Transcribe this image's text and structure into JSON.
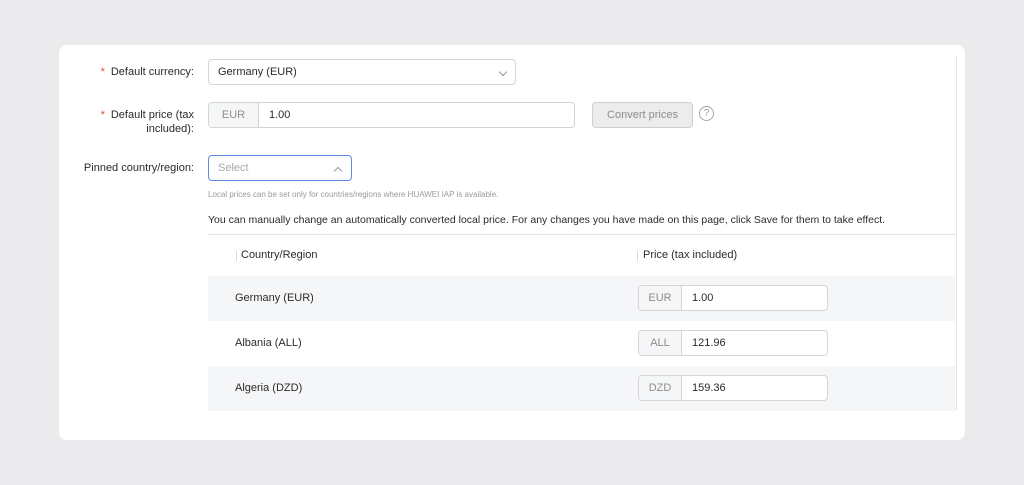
{
  "form": {
    "default_currency": {
      "label": "Default currency:",
      "value": "Germany (EUR)"
    },
    "default_price": {
      "label_line1": "Default price (tax",
      "label_line2": "included):",
      "currency": "EUR",
      "value": "1.00"
    },
    "convert_button": "Convert prices",
    "help_glyph": "?",
    "pinned": {
      "label": "Pinned country/region:",
      "placeholder": "Select"
    },
    "hint": "Local prices can be set only for countries/regions where HUAWEI IAP is available.",
    "note": "You can manually change an automatically converted local price. For any changes you have made on this page, click Save for them to take effect."
  },
  "table": {
    "headers": [
      "Country/Region",
      "Price (tax included)"
    ],
    "rows": [
      {
        "country": "Germany (EUR)",
        "currency": "EUR",
        "price": "1.00"
      },
      {
        "country": "Albania (ALL)",
        "currency": "ALL",
        "price": "121.96"
      },
      {
        "country": "Algeria (DZD)",
        "currency": "DZD",
        "price": "159.36"
      }
    ]
  },
  "colors": {
    "required": "#e84b3c",
    "focus": "#5a8cdc",
    "row_alt": "#f5f6f8"
  }
}
